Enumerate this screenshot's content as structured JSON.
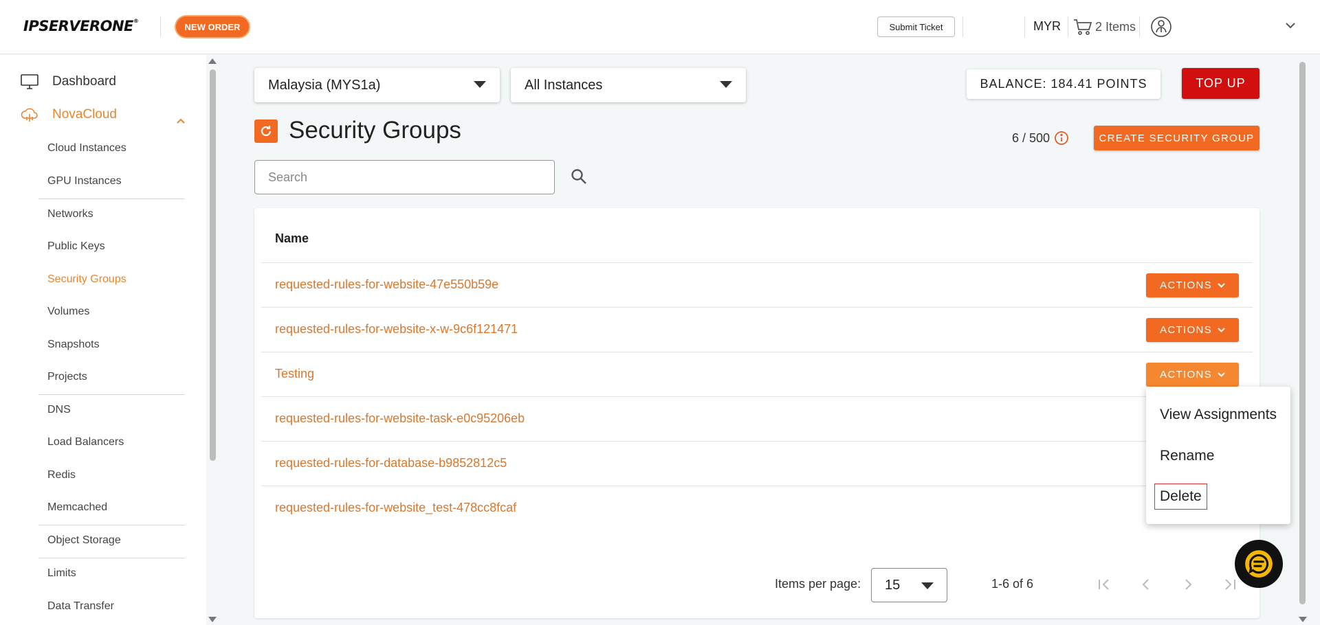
{
  "header": {
    "logo_text": "IPSERVERONE",
    "logo_mark": "®",
    "new_order_label": "NEW ORDER",
    "submit_ticket_label": "Submit Ticket",
    "currency": "MYR",
    "cart_label": "2 Items"
  },
  "sidebar": {
    "dashboard_label": "Dashboard",
    "novacloud_label": "NovaCloud",
    "items": [
      {
        "label": "Cloud Instances"
      },
      {
        "label": "GPU Instances"
      },
      {
        "label": "Networks"
      },
      {
        "label": "Public Keys"
      },
      {
        "label": "Security Groups",
        "active": true
      },
      {
        "label": "Volumes"
      },
      {
        "label": "Snapshots"
      },
      {
        "label": "Projects"
      },
      {
        "label": "DNS"
      },
      {
        "label": "Load Balancers"
      },
      {
        "label": "Redis"
      },
      {
        "label": "Memcached"
      },
      {
        "label": "Object Storage"
      },
      {
        "label": "Limits"
      },
      {
        "label": "Data Transfer"
      }
    ]
  },
  "filters": {
    "region": "Malaysia (MYS1a)",
    "instances": "All Instances"
  },
  "balance_label": "BALANCE: 184.41 POINTS",
  "top_up_label": "TOP UP",
  "page_title": "Security Groups",
  "quota": "6 / 500",
  "create_label": "CREATE SECURITY GROUP",
  "search": {
    "placeholder": "Search",
    "value": ""
  },
  "table": {
    "header_name": "Name",
    "actions_label": "ACTIONS",
    "rows": [
      {
        "name": "requested-rules-for-website-47e550b59e"
      },
      {
        "name": "requested-rules-for-website-x-w-9c6f121471"
      },
      {
        "name": "Testing"
      },
      {
        "name": "requested-rules-for-website-task-e0c95206eb"
      },
      {
        "name": "requested-rules-for-database-b9852812c5"
      },
      {
        "name": "requested-rules-for-website_test-478cc8fcaf"
      }
    ]
  },
  "actions_menu": {
    "items": [
      "View Assignments",
      "Rename",
      "Delete"
    ]
  },
  "pagination": {
    "items_per_page_label": "Items per page:",
    "items_per_page": "15",
    "range": "1-6 of 6"
  },
  "colors": {
    "accent": "#f26a21",
    "topup": "#d20f0f",
    "link": "#d9782f"
  }
}
